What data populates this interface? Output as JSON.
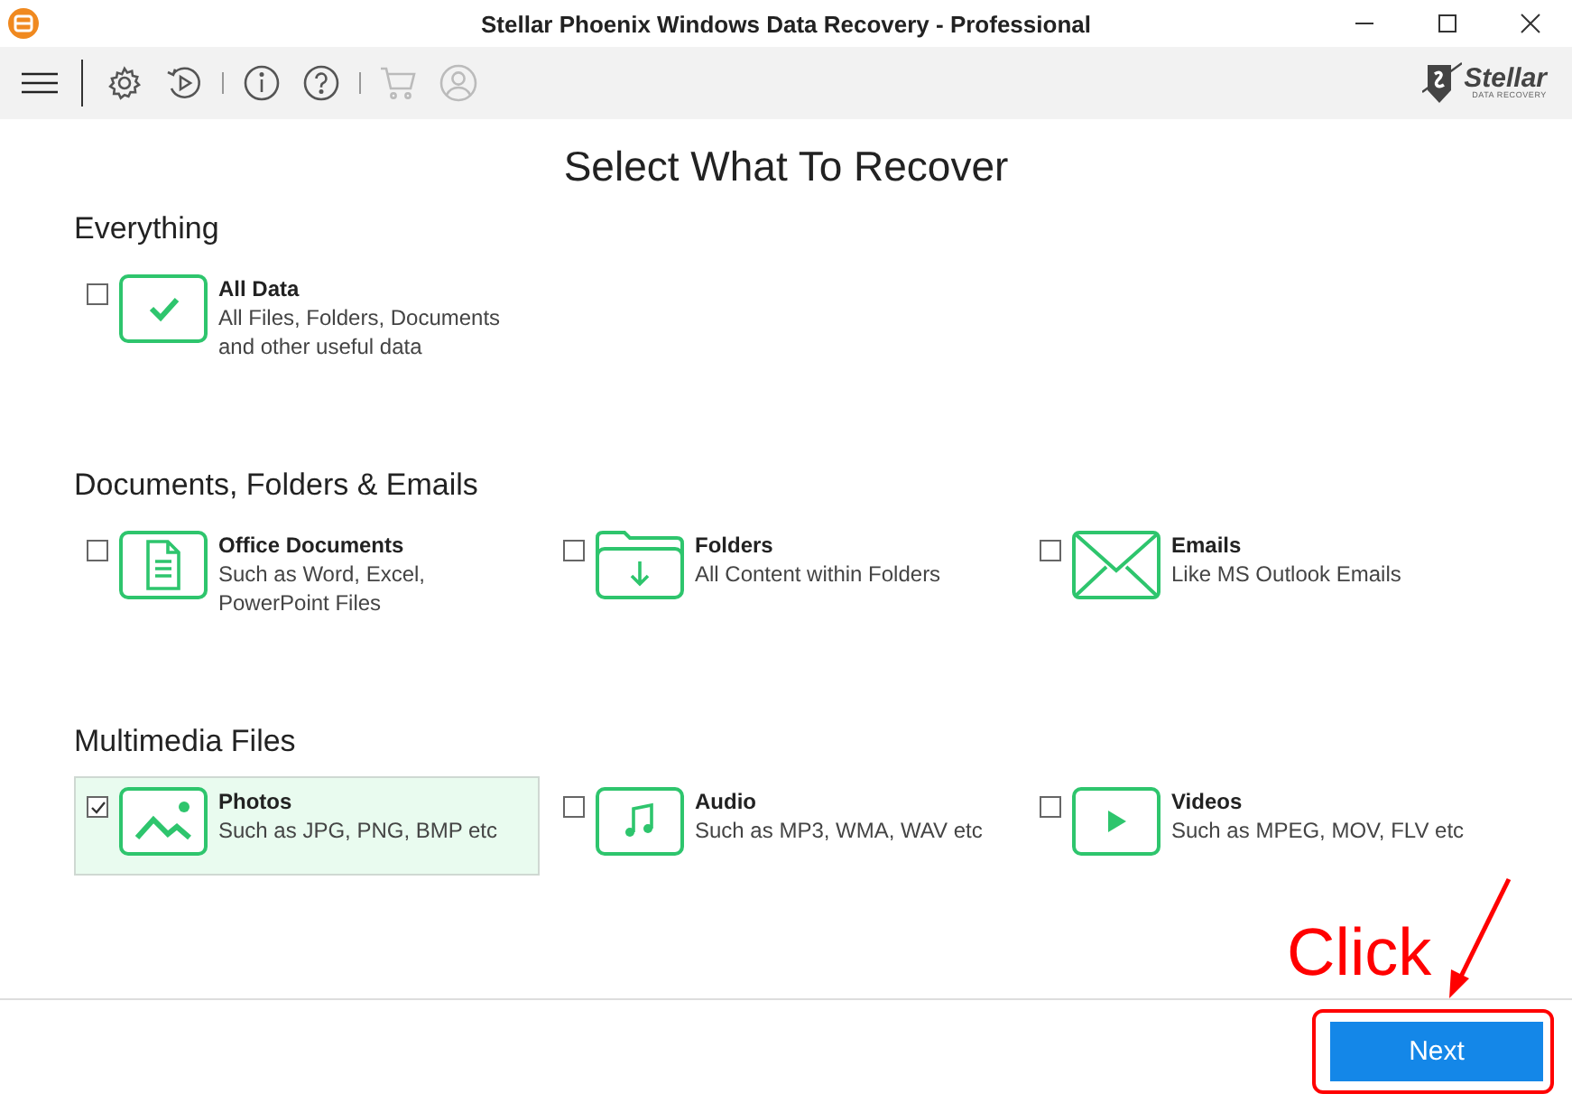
{
  "window": {
    "title": "Stellar Phoenix Windows Data Recovery - Professional"
  },
  "toolbar": [
    {
      "kind": "menu",
      "disabled": false
    },
    {
      "kind": "separator"
    },
    {
      "kind": "settings",
      "disabled": false
    },
    {
      "kind": "history",
      "disabled": false
    },
    {
      "kind": "separator"
    },
    {
      "kind": "info",
      "disabled": false
    },
    {
      "kind": "help",
      "disabled": false
    },
    {
      "kind": "separator"
    },
    {
      "kind": "cart",
      "disabled": true
    },
    {
      "kind": "account",
      "disabled": true
    }
  ],
  "logo": {
    "name": "Stellar",
    "tagline": "DATA RECOVERY"
  },
  "heading": "Select What To Recover",
  "sections": [
    {
      "title": "Everything",
      "items": [
        {
          "kind": "check",
          "label": "All Data",
          "description": "All Files, Folders, Documents and other useful data",
          "checked": false,
          "selected": false
        }
      ]
    },
    {
      "title": "Documents, Folders & Emails",
      "items": [
        {
          "kind": "document",
          "label": "Office Documents",
          "description": "Such as Word, Excel, PowerPoint Files",
          "checked": false,
          "selected": false
        },
        {
          "kind": "folder",
          "label": "Folders",
          "description": "All Content within Folders",
          "checked": false,
          "selected": false
        },
        {
          "kind": "email",
          "label": "Emails",
          "description": "Like MS Outlook Emails",
          "checked": false,
          "selected": false
        }
      ]
    },
    {
      "title": "Multimedia Files",
      "items": [
        {
          "kind": "photo",
          "label": "Photos",
          "description": "Such as JPG, PNG, BMP etc",
          "checked": true,
          "selected": true
        },
        {
          "kind": "audio",
          "label": "Audio",
          "description": "Such as MP3, WMA, WAV etc",
          "checked": false,
          "selected": false
        },
        {
          "kind": "video",
          "label": "Videos",
          "description": "Such as MPEG, MOV, FLV etc",
          "checked": false,
          "selected": false
        }
      ]
    }
  ],
  "next_button": "Next",
  "annotation": {
    "text": "Click"
  }
}
